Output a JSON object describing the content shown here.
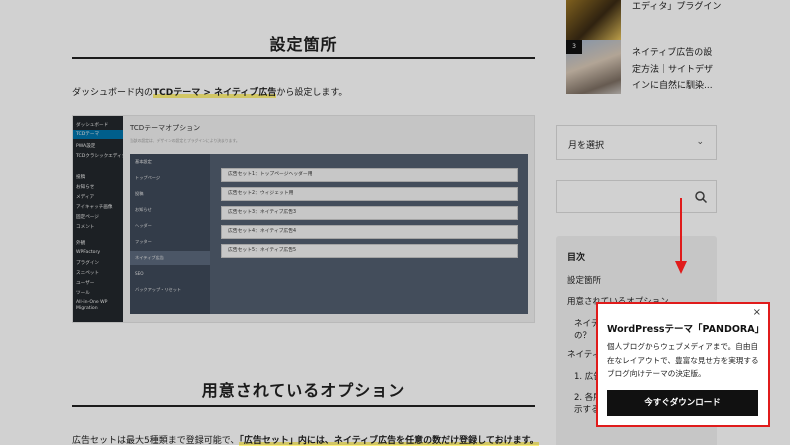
{
  "article": {
    "section1_heading": "設定箇所",
    "intro_before": "ダッシュボード内の",
    "intro_highlight": "TCDテーマ > ネイティブ広告",
    "intro_after": "から設定します。",
    "section2_heading": "用意されているオプション",
    "bottom_before": "広告セットは最大5種類まで登録可能で、",
    "bottom_highlight": "「広告セット」内には、ネイティブ広告を任意の数だけ登録しておけます。"
  },
  "screenshot": {
    "wp_menu": [
      "ダッシュボード",
      "TCDテーマ",
      "PWA設定",
      "TCDクラシックエディタ",
      "投稿",
      "お知らせ",
      "メディア",
      "アイキャッチ画像",
      "固定ページ",
      "コメント",
      "外観",
      "WPFactory",
      "プラグイン",
      "スニペット",
      "ユーザー",
      "ツール",
      "All-in-One WP Migration"
    ],
    "option_title": "TCDテーマオプション",
    "option_subtitle": "当該の設定は、デザインの設定とプラグインにより決まります。",
    "option_nav": [
      "基本設定",
      "トップページ",
      "投稿",
      "お知らせ",
      "ヘッダー",
      "フッター",
      "ネイティブ広告",
      "SEO",
      "バックアップ・リセット"
    ],
    "ad_sets": [
      "広告セット1：トップページヘッダー用",
      "広告セット2：ウィジェット用",
      "広告セット3：ネイティブ広告3",
      "広告セット4：ネイティブ広告4",
      "広告セット5：ネイティブ広告5"
    ]
  },
  "sidebar": {
    "ranking_item_1": "エディタ」プラグイン",
    "ranking_rank_3": "3",
    "ranking_item_3_lines": [
      "ネイティブ広告の設",
      "定方法｜サイトデザ",
      "インに自然に馴染..."
    ],
    "month_select": "月を選択",
    "month_chevron": "⌄",
    "toc_title": "目次",
    "toc_items": [
      "設定箇所",
      "用意されているオプション",
      "ネイティ",
      "の？",
      "ネイティ",
      "1. 広告",
      "2. 各所",
      "示する"
    ]
  },
  "popup": {
    "close": "×",
    "title": "WordPressテーマ「PANDORA」",
    "description": "個人ブログからウェブメディアまで。自由自在なレイアウトで、豊富な見せ方を実現するブログ向けテーマの決定版。",
    "cta": "今すぐダウンロード"
  },
  "colors": {
    "accent_red": "#e01b1b",
    "highlight_yellow": "#fff27a",
    "wp_blue": "#0073aa",
    "panel_slate": "#525e70"
  }
}
